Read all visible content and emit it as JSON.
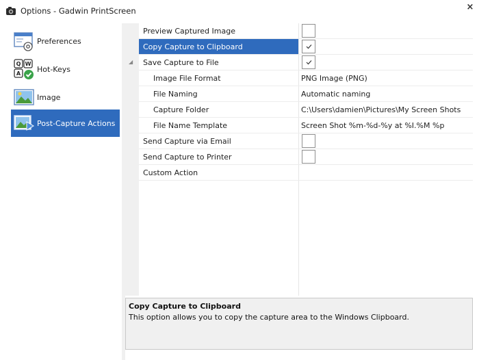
{
  "window": {
    "title": "Options - Gadwin PrintScreen",
    "close_label": "×"
  },
  "sidebar": {
    "items": [
      {
        "label": "Preferences",
        "icon": "preferences-icon"
      },
      {
        "label": "Hot-Keys",
        "icon": "hotkeys-icon"
      },
      {
        "label": "Image",
        "icon": "image-icon"
      },
      {
        "label": "Post-Capture Actions",
        "icon": "post-capture-icon",
        "selected": true
      }
    ]
  },
  "grid": {
    "rows": [
      {
        "name": "Preview Captured Image",
        "type": "checkbox",
        "checked": false
      },
      {
        "name": "Copy Capture to Clipboard",
        "type": "checkbox",
        "checked": true,
        "selected": true
      },
      {
        "name": "Save Capture to File",
        "type": "checkbox",
        "checked": true,
        "expanded": true,
        "expander": "◢"
      },
      {
        "name": "Image File Format",
        "type": "text",
        "value": "PNG Image (PNG)",
        "child": true
      },
      {
        "name": "File Naming",
        "type": "text",
        "value": "Automatic naming",
        "child": true
      },
      {
        "name": "Capture Folder",
        "type": "text",
        "value": "C:\\Users\\damien\\Pictures\\My Screen Shots",
        "child": true
      },
      {
        "name": "File Name Template",
        "type": "text",
        "value": "Screen Shot %m-%d-%y at %I.%M %p",
        "child": true
      },
      {
        "name": "Send Capture via Email",
        "type": "checkbox",
        "checked": false
      },
      {
        "name": "Send Capture to Printer",
        "type": "checkbox",
        "checked": false
      },
      {
        "name": "Custom Action",
        "type": "text",
        "value": ""
      }
    ]
  },
  "description": {
    "title": "Copy Capture to Clipboard",
    "text": "This option allows you to copy the capture area to the Windows Clipboard."
  },
  "colors": {
    "selection": "#2f6bbd",
    "gutter": "#f0f0f0"
  }
}
